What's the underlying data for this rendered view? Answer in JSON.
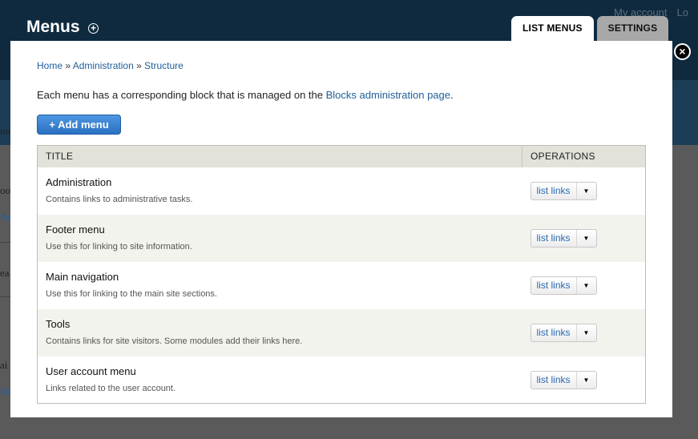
{
  "background": {
    "toplinks": [
      "My account",
      "Lo"
    ],
    "fragments": [
      "me",
      "oo",
      "Ad",
      "ea",
      "ai",
      "Ho"
    ]
  },
  "overlay": {
    "title": "Menus",
    "tabs": [
      {
        "label": "LIST MENUS",
        "active": true
      },
      {
        "label": "SETTINGS",
        "active": false
      }
    ],
    "close_label": "×"
  },
  "breadcrumb": {
    "items": [
      "Home",
      "Administration",
      "Structure"
    ],
    "separator": "»"
  },
  "intro": {
    "text_before": "Each menu has a corresponding block that is managed on the ",
    "link": "Blocks administration page",
    "text_after": "."
  },
  "add_button": {
    "label": "+ Add menu"
  },
  "table": {
    "headers": {
      "title": "TITLE",
      "operations": "OPERATIONS"
    },
    "rows": [
      {
        "title": "Administration",
        "description": "Contains links to administrative tasks.",
        "operation": "list links"
      },
      {
        "title": "Footer menu",
        "description": "Use this for linking to site information.",
        "operation": "list links"
      },
      {
        "title": "Main navigation",
        "description": "Use this for linking to the main site sections.",
        "operation": "list links"
      },
      {
        "title": "Tools",
        "description": "Contains links for site visitors. Some modules add their links here.",
        "operation": "list links"
      },
      {
        "title": "User account menu",
        "description": "Links related to the user account.",
        "operation": "list links"
      }
    ]
  },
  "icons": {
    "shortcut": "add-shortcut-icon",
    "close": "close-icon",
    "dropdown": "chevron-down-icon"
  },
  "colors": {
    "link": "#1f5f9a",
    "primary_button": "#2b70c2",
    "header_bg": "#0f2a3f"
  }
}
